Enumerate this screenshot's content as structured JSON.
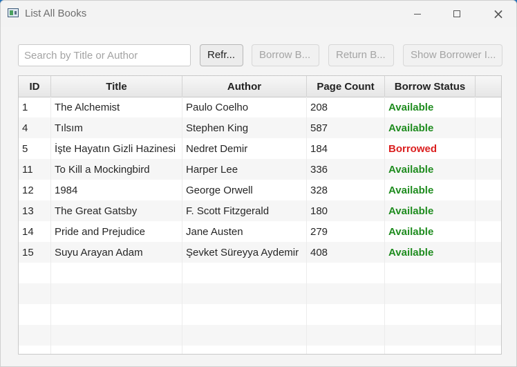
{
  "window": {
    "title": "List All Books",
    "controls": {
      "minimize": "minimize-icon",
      "maximize": "maximize-icon",
      "close": "close-icon"
    }
  },
  "search": {
    "placeholder": "Search by Title or Author",
    "value": ""
  },
  "toolbar": {
    "refresh": "Refr...",
    "borrow": "Borrow B...",
    "return": "Return B...",
    "show_borrower": "Show Borrower I..."
  },
  "table": {
    "columns": [
      "ID",
      "Title",
      "Author",
      "Page Count",
      "Borrow Status",
      ""
    ],
    "rows": [
      {
        "id": "1",
        "title": "The Alchemist",
        "author": "Paulo Coelho",
        "pages": "208",
        "status": "Available"
      },
      {
        "id": "4",
        "title": "Tılsım",
        "author": "Stephen King",
        "pages": "587",
        "status": "Available"
      },
      {
        "id": "5",
        "title": "İşte Hayatın Gizli Hazinesi",
        "author": "Nedret Demir",
        "pages": "184",
        "status": "Borrowed"
      },
      {
        "id": "11",
        "title": "To Kill a Mockingbird",
        "author": "Harper Lee",
        "pages": "336",
        "status": "Available"
      },
      {
        "id": "12",
        "title": "1984",
        "author": "George Orwell",
        "pages": "328",
        "status": "Available"
      },
      {
        "id": "13",
        "title": "The Great Gatsby",
        "author": "F. Scott Fitzgerald",
        "pages": "180",
        "status": "Available"
      },
      {
        "id": "14",
        "title": "Pride and Prejudice",
        "author": "Jane Austen",
        "pages": "279",
        "status": "Available"
      },
      {
        "id": "15",
        "title": "Suyu Arayan Adam",
        "author": "Şevket Süreyya Aydemir",
        "pages": "408",
        "status": "Available"
      }
    ]
  },
  "colors": {
    "available": "#1f8c1f",
    "borrowed": "#db1f1f"
  }
}
